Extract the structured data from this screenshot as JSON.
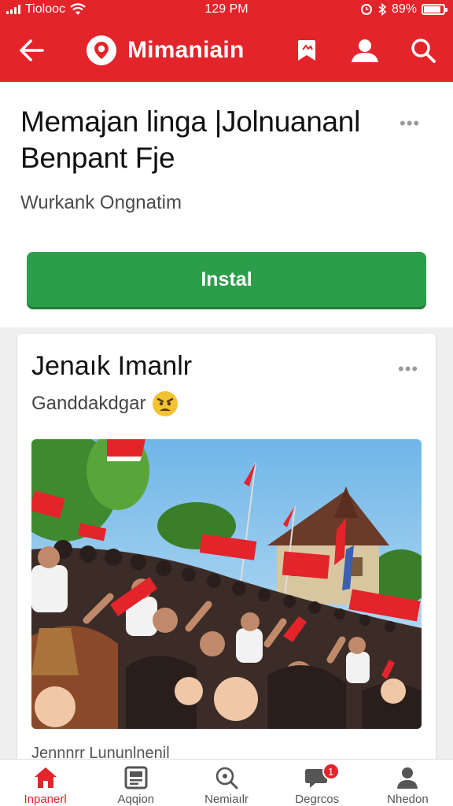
{
  "status_bar": {
    "carrier": "Tiolooc",
    "time": "129 PM",
    "battery_text": "89%",
    "battery_level": 0.89
  },
  "app_bar": {
    "title": "Mimaniain",
    "icons": [
      "back-arrow-icon",
      "brand-logo-icon",
      "bookmark-icon",
      "profile-icon",
      "search-icon"
    ]
  },
  "top_card": {
    "title": "Memajan linga |Jolnuananl Benpant Fje",
    "subtitle": "Wurkank Ongnatim",
    "more": "•••",
    "install_label": "Instal"
  },
  "post": {
    "title": "Jenaık Imanlr",
    "subtitle": "Ganddakdgar",
    "more": "•••",
    "caption": "Jennnrr Lununlnenil"
  },
  "bottom_nav": {
    "items": [
      {
        "label": "Inpanerl",
        "icon": "home-icon",
        "active": true
      },
      {
        "label": "Aqqion",
        "icon": "news-icon",
        "active": false
      },
      {
        "label": "Nemiaılr",
        "icon": "explore-icon",
        "active": false
      },
      {
        "label": "Degrcos",
        "icon": "chat-icon",
        "active": false,
        "badge": "1"
      },
      {
        "label": "Nhedon",
        "icon": "account-icon",
        "active": false
      }
    ]
  },
  "colors": {
    "brand_red": "#e3242b",
    "install_green": "#2c9e4b"
  }
}
